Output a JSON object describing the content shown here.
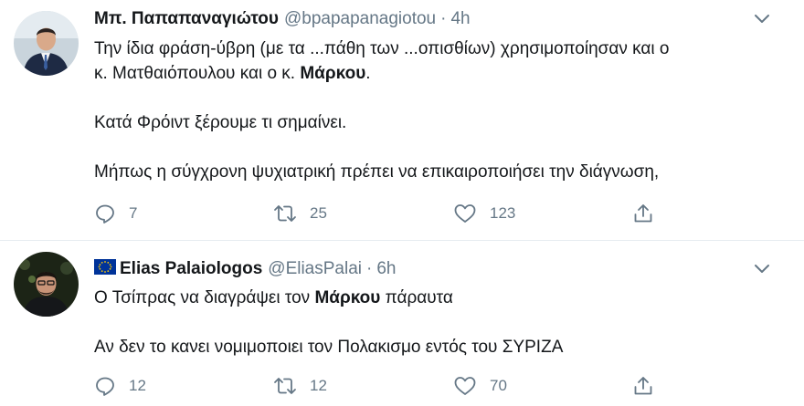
{
  "tweets": [
    {
      "author_name": "Μπ. Παπαπαναγιώτου",
      "handle": "@bpapapanagiotou",
      "separator": "·",
      "time": "4h",
      "lines": [
        [
          "Την ίδια φράση-ύβρη (με τα ...πάθη των ...οπισθίων) χρησιμοποίησαν και ο"
        ],
        [
          "κ. Ματθαιόπουλου και ο κ. ",
          {
            "bold": "Μάρκου"
          },
          "."
        ],
        [],
        [
          "Κατά Φρόιντ ξέρουμε τι σημαίνει."
        ],
        [],
        [
          "Μήπως η σύγχρονη ψυχιατρική πρέπει να επικαιροποιήσει την διάγνωση,"
        ]
      ],
      "line_1": "Την ίδια φράση-ύβρη (με τα ...πάθη των ...οπισθίων) χρησιμοποίησαν και ο",
      "line_2_pre": "κ. Ματθαιόπουλου και ο κ. ",
      "line_2_bold": "Μάρκου",
      "line_2_post": ".",
      "line_3": "Κατά Φρόιντ ξέρουμε τι σημαίνει.",
      "line_4": "Μήπως η σύγχρονη ψυχιατρική πρέπει να επικαιροποιήσει την διάγνωση,",
      "replies": "7",
      "retweets": "25",
      "likes": "123"
    },
    {
      "author_name": "Elias Palaiologos",
      "handle": "@EliasPalai",
      "separator": "·",
      "time": "6h",
      "line_1_pre": "Ο Τσίπρας να διαγράψει τον ",
      "line_1_bold": "Μάρκου",
      "line_1_post": " πάραυτα",
      "line_2": "Αν δεν το κανει νομιμοποιει τον Πολακισμο εντός του ΣΥΡΙΖΑ",
      "replies": "12",
      "retweets": "12",
      "likes": "70"
    }
  ],
  "icons": {
    "caret": "chevron-down-icon",
    "reply": "reply-icon",
    "retweet": "retweet-icon",
    "like": "heart-icon",
    "share": "share-icon",
    "flag": "eu-flag-icon"
  },
  "colors": {
    "text": "#14171a",
    "secondary": "#657786",
    "divider": "#e6ecf0",
    "eu_blue": "#003399",
    "eu_star": "#ffcc00"
  }
}
